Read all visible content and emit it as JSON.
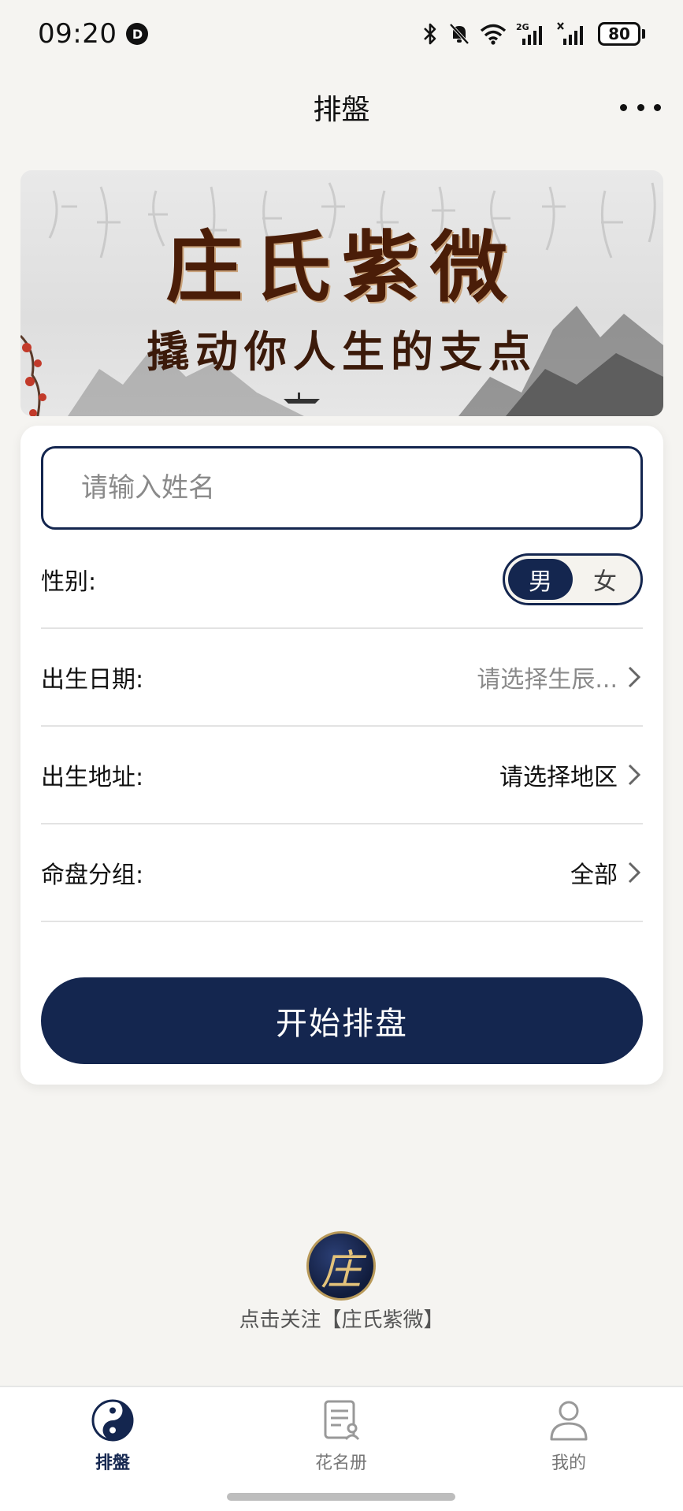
{
  "status_bar": {
    "time": "09:20",
    "notification_icon_letter": "D",
    "network_label": "2G",
    "battery": "80"
  },
  "nav": {
    "title": "排盤"
  },
  "banner": {
    "title": "庄氏紫微",
    "slogan": "撬动你人生的支点"
  },
  "form": {
    "name_placeholder": "请输入姓名",
    "gender_label": "性别:",
    "gender_options": [
      "男",
      "女"
    ],
    "gender_selected": "男",
    "birth_date_label": "出生日期:",
    "birth_date_value": "请选择生辰...",
    "birth_place_label": "出生地址:",
    "birth_place_value": "请选择地区",
    "group_label": "命盘分组:",
    "group_value": "全部",
    "submit_label": "开始排盘"
  },
  "follow": {
    "logo_char": "庄",
    "text": "点击关注【庄氏紫微】"
  },
  "tab_bar": {
    "items": [
      {
        "label": "排盤",
        "icon": "yin-yang-icon",
        "active": true
      },
      {
        "label": "花名册",
        "icon": "roster-icon",
        "active": false
      },
      {
        "label": "我的",
        "icon": "user-icon",
        "active": false
      }
    ]
  },
  "colors": {
    "primary": "#14264f",
    "background": "#f5f4f1",
    "banner_text": "#4a1d08"
  }
}
